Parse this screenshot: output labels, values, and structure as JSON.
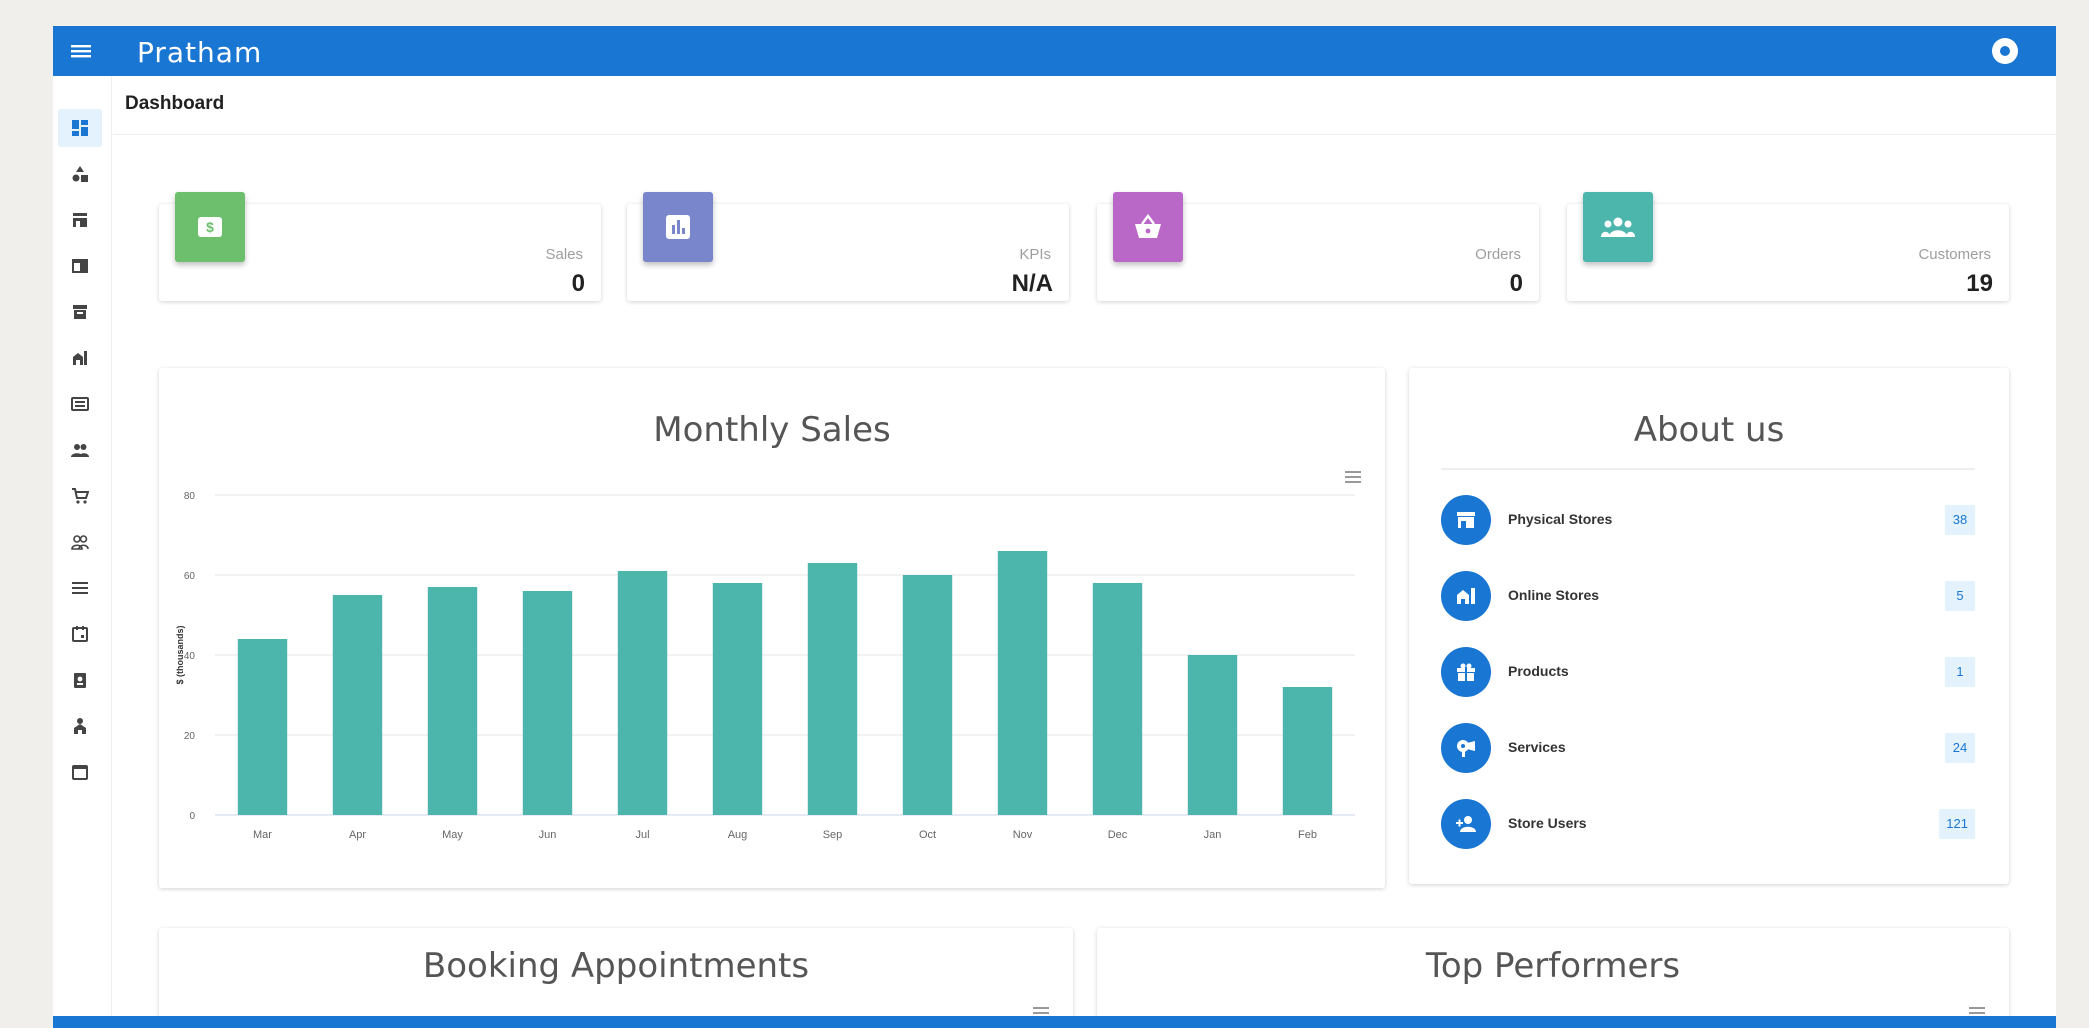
{
  "app": {
    "brand": "Pratham"
  },
  "colors": {
    "primary": "#1976d2",
    "sales": "#6dbf6d",
    "kpis": "#7986cb",
    "orders": "#ba68c8",
    "customers": "#4db6ac",
    "bar": "#4db6ac"
  },
  "sidebar": {
    "items": [
      {
        "icon": "dashboard-icon",
        "active": true
      },
      {
        "icon": "category-icon"
      },
      {
        "icon": "store-icon"
      },
      {
        "icon": "web-icon"
      },
      {
        "icon": "archive-icon"
      },
      {
        "icon": "online-store-icon"
      },
      {
        "icon": "card-icon"
      },
      {
        "icon": "people-icon"
      },
      {
        "icon": "cart-icon"
      },
      {
        "icon": "groups-icon"
      },
      {
        "icon": "list-icon"
      },
      {
        "icon": "event-icon"
      },
      {
        "icon": "badge-icon"
      },
      {
        "icon": "user-tree-icon"
      },
      {
        "icon": "calendar-icon"
      }
    ]
  },
  "breadcrumb": "Dashboard",
  "stats": [
    {
      "label": "Sales",
      "value": "0",
      "icon": "dollar-icon"
    },
    {
      "label": "KPIs",
      "value": "N/A",
      "icon": "bar-chart-icon"
    },
    {
      "label": "Orders",
      "value": "0",
      "icon": "basket-icon"
    },
    {
      "label": "Customers",
      "value": "19",
      "icon": "people-icon"
    }
  ],
  "monthly_sales": {
    "title": "Monthly Sales"
  },
  "chart_data": {
    "type": "bar",
    "title": "Monthly Sales",
    "categories": [
      "Mar",
      "Apr",
      "May",
      "Jun",
      "Jul",
      "Aug",
      "Sep",
      "Oct",
      "Nov",
      "Dec",
      "Jan",
      "Feb"
    ],
    "values": [
      44,
      55,
      57,
      56,
      61,
      58,
      63,
      60,
      66,
      58,
      40,
      32
    ],
    "ylabel": "$ (thousands)",
    "xlabel": "",
    "ylim": [
      0,
      80
    ],
    "yticks": [
      "0",
      "20",
      "40",
      "60",
      "80"
    ],
    "grid": true,
    "legend": "none"
  },
  "about": {
    "title": "About us",
    "items": [
      {
        "label": "Physical Stores",
        "count": "38",
        "icon": "store-icon"
      },
      {
        "label": "Online Stores",
        "count": "5",
        "icon": "online-store-icon"
      },
      {
        "label": "Products",
        "count": "1",
        "icon": "gift-icon"
      },
      {
        "label": "Services",
        "count": "24",
        "icon": "hair-dryer-icon"
      },
      {
        "label": "Store Users",
        "count": "121",
        "icon": "add-user-icon"
      }
    ]
  },
  "booking": {
    "title": "Booking Appointments"
  },
  "top_performers": {
    "title": "Top Performers"
  }
}
